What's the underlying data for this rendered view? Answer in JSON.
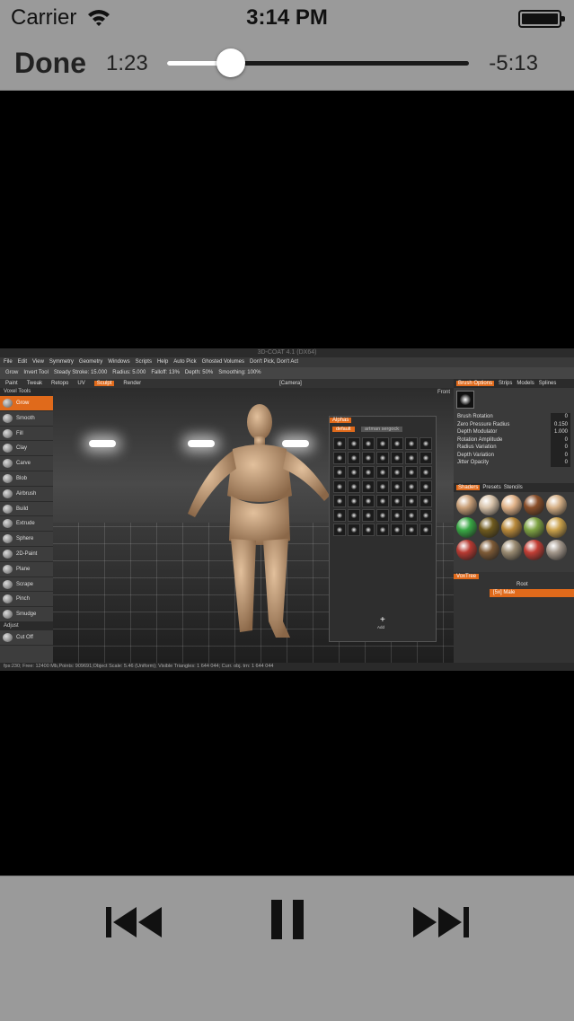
{
  "status_bar": {
    "carrier": "Carrier",
    "time": "3:14 PM"
  },
  "player": {
    "done_label": "Done",
    "elapsed": "1:23",
    "remaining": "-5:13",
    "progress": 0.21
  },
  "video_frame": {
    "title": "3D-COAT 4.1 (DX64)",
    "menu": [
      "File",
      "Edit",
      "View",
      "Symmetry",
      "Geometry",
      "Windows",
      "Scripts",
      "Help",
      "Auto Pick",
      "Ghosted Volumes",
      "Don't Pick, Don't Act"
    ],
    "options": [
      "Grow",
      "Invert Tool",
      "Steady Stroke: 15.000",
      "Radius: 5.000",
      "Falloff: 13%",
      "Depth: 50%",
      "Smoothing: 100%"
    ],
    "room_tabs": [
      "Paint",
      "Tweak",
      "Retopo",
      "UV",
      "Sculpt",
      "Render"
    ],
    "active_room": "Sculpt",
    "camera_label": "[Camera]",
    "view_label": "Front",
    "tools_header": "Voxel Tools",
    "tools": [
      "Grow",
      "Smooth",
      "Fill",
      "Clay",
      "Carve",
      "Blob",
      "Airbrush",
      "Build",
      "Extrude",
      "Sphere",
      "2D-Paint",
      "Plane",
      "Scrape",
      "Pinch",
      "Smudge"
    ],
    "active_tool": "Grow",
    "adjust_label": "Adjust",
    "cut_off_label": "Cut Off",
    "alphas": {
      "title": "Alphas",
      "tab_default": "default",
      "tab_other": "artman sergock",
      "add_label": "Add"
    },
    "right_tabs": [
      "Brush Options",
      "Strips",
      "Models",
      "Splines"
    ],
    "brush_props": [
      {
        "label": "Brush Rotation",
        "value": "0"
      },
      {
        "label": "Zero Pressure Radius",
        "value": "0.150"
      },
      {
        "label": "Depth Modulator",
        "value": "1.000"
      },
      {
        "label": "Rotation Amplitude",
        "value": "0"
      },
      {
        "label": "Radius Variation",
        "value": "0"
      },
      {
        "label": "Depth Variation",
        "value": "0"
      },
      {
        "label": "Jitter Opacity",
        "value": "0"
      }
    ],
    "shader_tabs": [
      "Shaders",
      "Presets",
      "Stencils"
    ],
    "shader_colors": [
      "#c9a079",
      "#d7c2a9",
      "#e2b48a",
      "#8a4f2a",
      "#d6b086",
      "#39a845",
      "#6f5a1e",
      "#b8893b",
      "#7fa344",
      "#caa14b",
      "#b73a32",
      "#7d5a36",
      "#9a8b72",
      "#c23e35",
      "#a3978b"
    ],
    "voxtree": {
      "title": "VoxTree",
      "root": "Root",
      "item": "[5x] Male"
    },
    "status": "fps:230;   Free: 12400 Mb,Points: 909691;Object Scale: 5.46 (Uniform); Visible Triangles: 1 644 044; Curr. obj. trn: 1 644 044"
  }
}
